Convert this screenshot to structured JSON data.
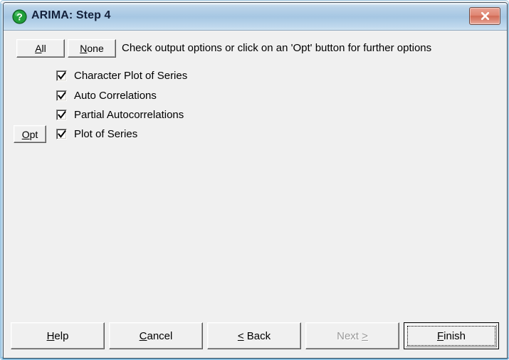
{
  "window": {
    "title": "ARIMA: Step 4",
    "icon": "question-mark-icon",
    "close_label": "✖"
  },
  "toolbar": {
    "all_label": "All",
    "all_mnemonic": "A",
    "none_label": "None",
    "none_mnemonic": "N",
    "instruction": "Check output options or click on an 'Opt' button for further options"
  },
  "options": {
    "opt_button_label": "Opt",
    "opt_button_mnemonic": "O",
    "items": [
      {
        "label": "Character Plot of Series",
        "checked": true,
        "has_opt": false
      },
      {
        "label": "Auto Correlations",
        "checked": true,
        "has_opt": false
      },
      {
        "label": "Partial Autocorrelations",
        "checked": true,
        "has_opt": false
      },
      {
        "label": "Plot of Series",
        "checked": true,
        "has_opt": true
      }
    ]
  },
  "footer": {
    "help": {
      "label": "Help",
      "pre": "",
      "mnemonic": "H",
      "post": "elp",
      "disabled": false,
      "default": false
    },
    "cancel": {
      "label": "Cancel",
      "pre": "",
      "mnemonic": "C",
      "post": "ancel",
      "disabled": false,
      "default": false
    },
    "back": {
      "label": "< Back",
      "pre": "",
      "mnemonic": "<",
      "post": " Back",
      "disabled": false,
      "default": false
    },
    "next": {
      "label": "Next >",
      "pre": "Next ",
      "mnemonic": ">",
      "post": "",
      "disabled": true,
      "default": false
    },
    "finish": {
      "label": "Finish",
      "pre": "",
      "mnemonic": "F",
      "post": "inish",
      "disabled": false,
      "default": true
    }
  },
  "colors": {
    "dialog_background": "#f0f0f0",
    "titlebar_blue": "#a8c8e4",
    "close_red": "#d16b55",
    "icon_green": "#1f9e3a",
    "disabled_gray": "#9a9a9a",
    "frame_outline": "#4a5560",
    "aero_glow": "#7fb9dd"
  }
}
